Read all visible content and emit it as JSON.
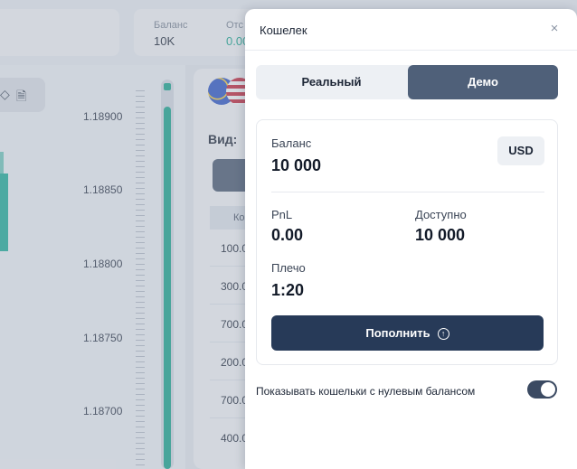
{
  "background": {
    "top_stats": [
      {
        "label": "Баланс",
        "value": "10K"
      },
      {
        "label": "Отс",
        "value": "0.00"
      }
    ],
    "price_axis": [
      "1.18900",
      "1.18850",
      "1.18800",
      "1.18750",
      "1.18700"
    ],
    "order_panel": {
      "view_label": "Вид: ",
      "column_header": "Ко",
      "rows": [
        "100.0",
        "300.0",
        "700.0",
        "200.0",
        "700.0",
        "400.0"
      ]
    }
  },
  "wallet": {
    "title": "Кошелек",
    "close_symbol": "×",
    "tabs": [
      {
        "label": "Реальный",
        "active": false
      },
      {
        "label": "Демо",
        "active": true
      }
    ],
    "balance_label": "Баланс",
    "balance_value": "10 000",
    "currency": "USD",
    "pnl_label": "PnL",
    "pnl_value": "0.00",
    "available_label": "Доступно",
    "available_value": "10 000",
    "leverage_label": "Плечо",
    "leverage_value": "1:20",
    "topup_label": "Пополнить",
    "topup_icon": "arrow-up-circle-icon",
    "show_zero_label": "Показывать кошельки с нулевым балансом",
    "show_zero_enabled": true
  },
  "colors": {
    "accent_dark": "#273a58",
    "tab_active": "#4f6079",
    "candle_green": "#1fb09a"
  }
}
